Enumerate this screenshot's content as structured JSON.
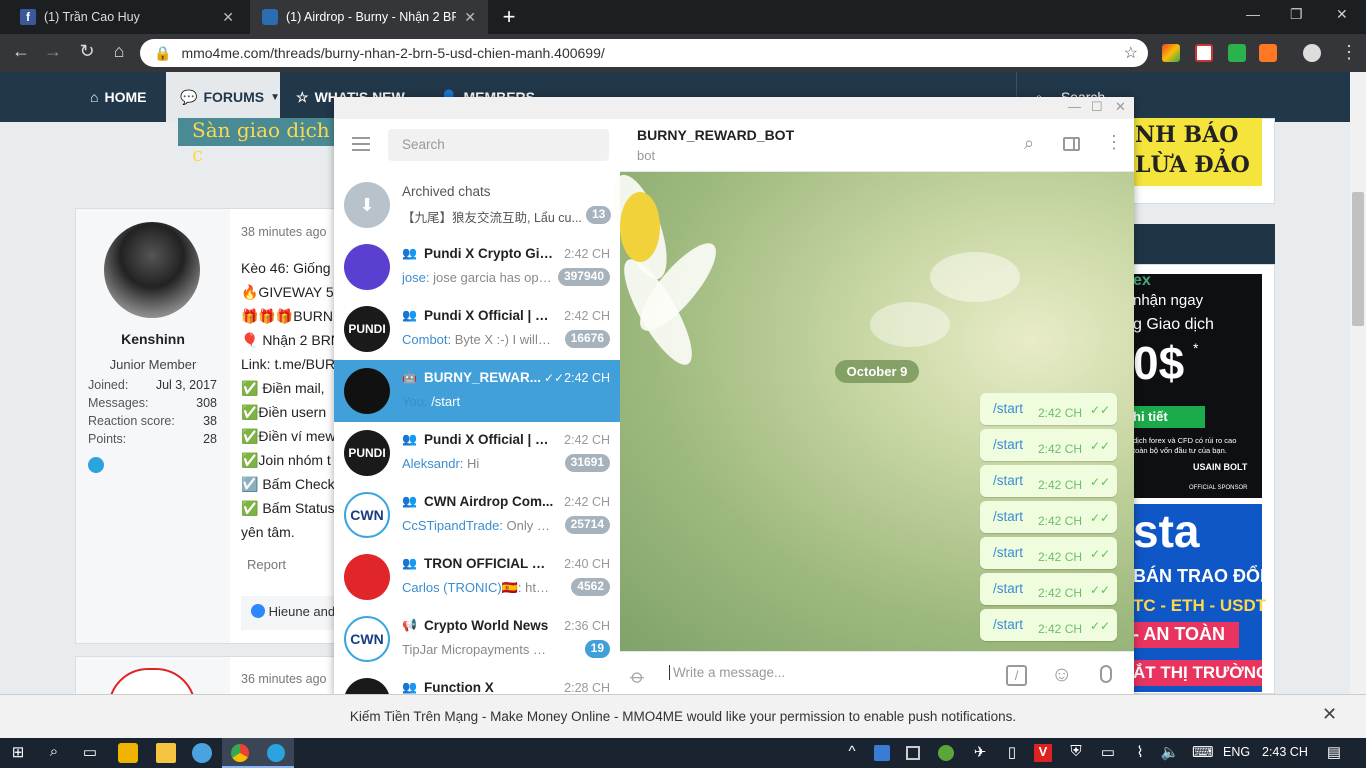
{
  "browser": {
    "tabs": [
      {
        "title": "(1) Trần Cao Huy",
        "active": false
      },
      {
        "title": "(1) Airdrop - Burny - Nhận 2 BRN",
        "active": true
      }
    ],
    "url": "mmo4me.com/threads/burny-nhan-2-brn-5-usd-chien-manh.400699/"
  },
  "forum": {
    "nav": [
      "HOME",
      "FORUMS",
      "WHAT'S NEW",
      "MEMBERS"
    ],
    "search": "Search",
    "banner_text": "Sàn giao dịch c",
    "warning": [
      "NH BÁO",
      "LỪA ĐẢO"
    ],
    "post1": {
      "time": "38 minutes ago",
      "username": "Kenshinn",
      "rank": "Junior Member",
      "stats": [
        {
          "k": "Joined:",
          "v": "Jul 3, 2017"
        },
        {
          "k": "Messages:",
          "v": "308"
        },
        {
          "k": "Reaction score:",
          "v": "38"
        },
        {
          "k": "Points:",
          "v": "28"
        }
      ],
      "lines": [
        "Kèo 46: Giống",
        "🔥GIVEWAY 5",
        "🎁🎁🎁BURN",
        "🎈 Nhận 2 BRN",
        "Link: t.me/BUR",
        "✅ Điền mail,",
        "✅Điền usern",
        "✅Điền ví mew",
        "✅Join nhóm t",
        "☑️ Bấm Check",
        "✅ Bấm Status",
        "yên tâm."
      ],
      "report": "Report",
      "reactions": "Hieune and"
    },
    "post2": {
      "time": "36 minutes ago"
    },
    "ads": {
      "ad1": [
        "ex",
        "nhận ngay",
        "g Giao dịch",
        "0$",
        "*",
        "hi tiết",
        "dịch forex và CFD có rủi ro cao",
        "toàn bộ vốn đầu tư của bạn.",
        "USAIN BOLT",
        "OFFICIAL SPONSOR"
      ],
      "ad2": [
        "sta",
        "BÁN TRAO ĐỔI",
        "TC - ETH - USDT",
        "- AN TOÀN",
        "ẮT THỊ TRƯỜNG"
      ]
    }
  },
  "telegram": {
    "search": "Search",
    "archived": {
      "name": "Archived chats",
      "preview": "【九尾】狼友交流互助, Lẩu cu...",
      "count": "13"
    },
    "chats": [
      {
        "name": "Pundi X Crypto Gift ...",
        "time": "2:42 CH",
        "sender": "jose:",
        "preview": "jose garcia has ope...",
        "count": "397940",
        "type": "group",
        "avatar": "#5b3fd1",
        "selected": false
      },
      {
        "name": "Pundi X Official | N...",
        "time": "2:42 CH",
        "sender": "Combot:",
        "preview": "Byte X :-) I will n...",
        "count": "16676",
        "type": "group",
        "avatar": "#1a1a1a",
        "selected": false
      },
      {
        "name": "BURNY_REWAR...",
        "time": "2:42 CH",
        "sender": "You:",
        "preview": "/start",
        "count": "",
        "type": "bot",
        "avatar": "#111111",
        "selected": true
      },
      {
        "name": "Pundi X Official | En...",
        "time": "2:42 CH",
        "sender": "Aleksandr:",
        "preview": "Hi",
        "count": "31691",
        "type": "group",
        "avatar": "#1a1a1a",
        "selected": false
      },
      {
        "name": "CWN Airdrop Com...",
        "time": "2:42 CH",
        "sender": "CcSTipandTrade:",
        "preview": "Only gr...",
        "count": "25714",
        "type": "group",
        "avatar": "#ffffff",
        "selected": false
      },
      {
        "name": "TRON OFFICIAL MAI...",
        "time": "2:40 CH",
        "sender": "Carlos (TRONIC)🇪🇸:",
        "preview": "https:...",
        "count": "4562",
        "type": "group",
        "avatar": "#e0262b",
        "selected": false
      },
      {
        "name": "Crypto World News",
        "time": "2:36 CH",
        "sender": "",
        "preview": "TipJar Micropayments Platfo...",
        "count": "19",
        "type": "channel",
        "avatar": "#ffffff",
        "selected": false
      },
      {
        "name": "Function X",
        "time": "2:28 CH",
        "sender": "",
        "preview": "",
        "count": "",
        "type": "group",
        "avatar": "#1a1a1a",
        "selected": false
      }
    ],
    "pundi_label": "PUNDI",
    "cwn_label": "CWN",
    "header": {
      "name": "BURNY_REWARD_BOT",
      "status": "bot"
    },
    "date": "October 9",
    "messages": [
      {
        "text": "/start",
        "time": "2:42 CH"
      },
      {
        "text": "/start",
        "time": "2:42 CH"
      },
      {
        "text": "/start",
        "time": "2:42 CH"
      },
      {
        "text": "/start",
        "time": "2:42 CH"
      },
      {
        "text": "/start",
        "time": "2:42 CH"
      },
      {
        "text": "/start",
        "time": "2:42 CH"
      },
      {
        "text": "/start",
        "time": "2:42 CH"
      }
    ],
    "input_placeholder": "Write a message..."
  },
  "notification": "Kiếm Tiền Trên Mạng - Make Money Online - MMO4ME would like your permission to enable push notifications.",
  "taskbar": {
    "lang": "ENG",
    "clock": "2:43 CH"
  }
}
